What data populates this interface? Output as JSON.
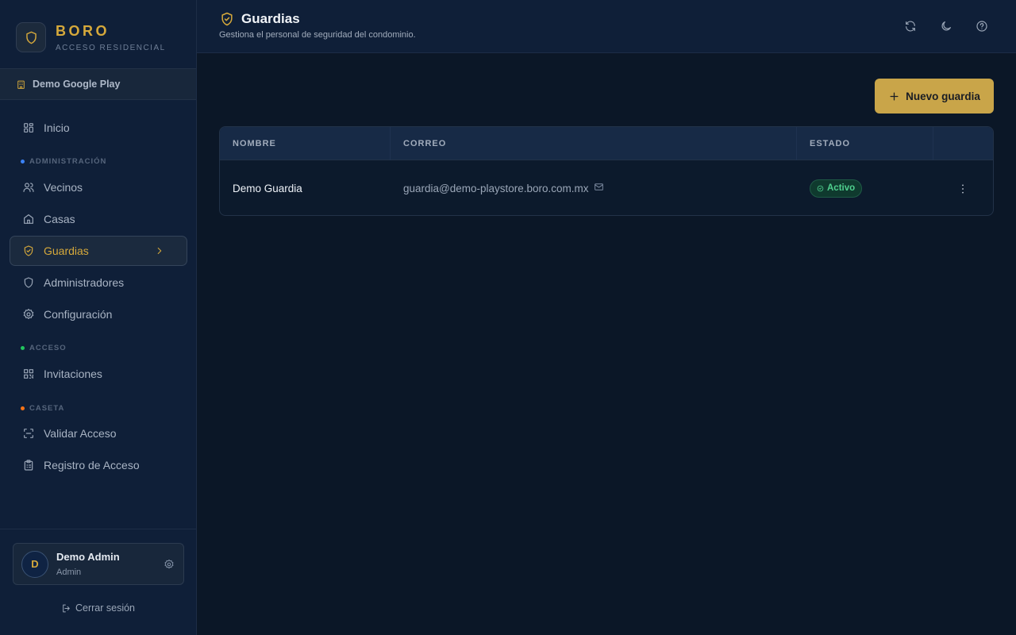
{
  "brand": {
    "name": "BORO",
    "subtitle": "ACCESO RESIDENCIAL"
  },
  "org": {
    "name": "Demo Google Play"
  },
  "nav": {
    "inicio": "Inicio",
    "sections": {
      "administracion": "ADMINISTRACIÓN",
      "acceso": "ACCESO",
      "caseta": "CASETA"
    },
    "vecinos": "Vecinos",
    "casas": "Casas",
    "guardias": "Guardias",
    "administradores": "Administradores",
    "configuracion": "Configuración",
    "invitaciones": "Invitaciones",
    "validar_acceso": "Validar Acceso",
    "registro_acceso": "Registro de Acceso"
  },
  "user": {
    "initial": "D",
    "name": "Demo Admin",
    "role": "Admin",
    "logout": "Cerrar sesión"
  },
  "header": {
    "title": "Guardias",
    "subtitle": "Gestiona el personal de seguridad del condominio."
  },
  "main": {
    "new_button": "Nuevo guardia"
  },
  "table": {
    "columns": {
      "nombre": "NOMBRE",
      "correo": "CORREO",
      "estado": "ESTADO"
    },
    "rows": [
      {
        "nombre": "Demo Guardia",
        "correo": "guardia@demo-playstore.boro.com.mx",
        "estado": "Activo"
      }
    ]
  },
  "icons": {
    "logo": "shield-icon",
    "org": "building-icon",
    "inicio": "dashboard-icon",
    "vecinos": "users-icon",
    "casas": "home-icon",
    "guardias": "shield-check-icon",
    "administradores": "shield-icon",
    "configuracion": "gear-icon",
    "invitaciones": "qr-code-icon",
    "validar": "scan-icon",
    "registro": "clipboard-icon",
    "refresh": "refresh-icon",
    "theme": "moon-icon",
    "help": "help-icon",
    "add": "plus-icon",
    "mail": "mail-icon",
    "actions": "more-vertical-icon",
    "logout": "logout-icon"
  },
  "colors": {
    "accent": "#d6a93b",
    "sidebar_bg": "#0f1f38",
    "main_bg": "#0b1727",
    "dot_administracion": "#3b82f6",
    "dot_acceso": "#22c55e",
    "dot_caseta": "#f97316",
    "active_status": "#4fd08e"
  }
}
